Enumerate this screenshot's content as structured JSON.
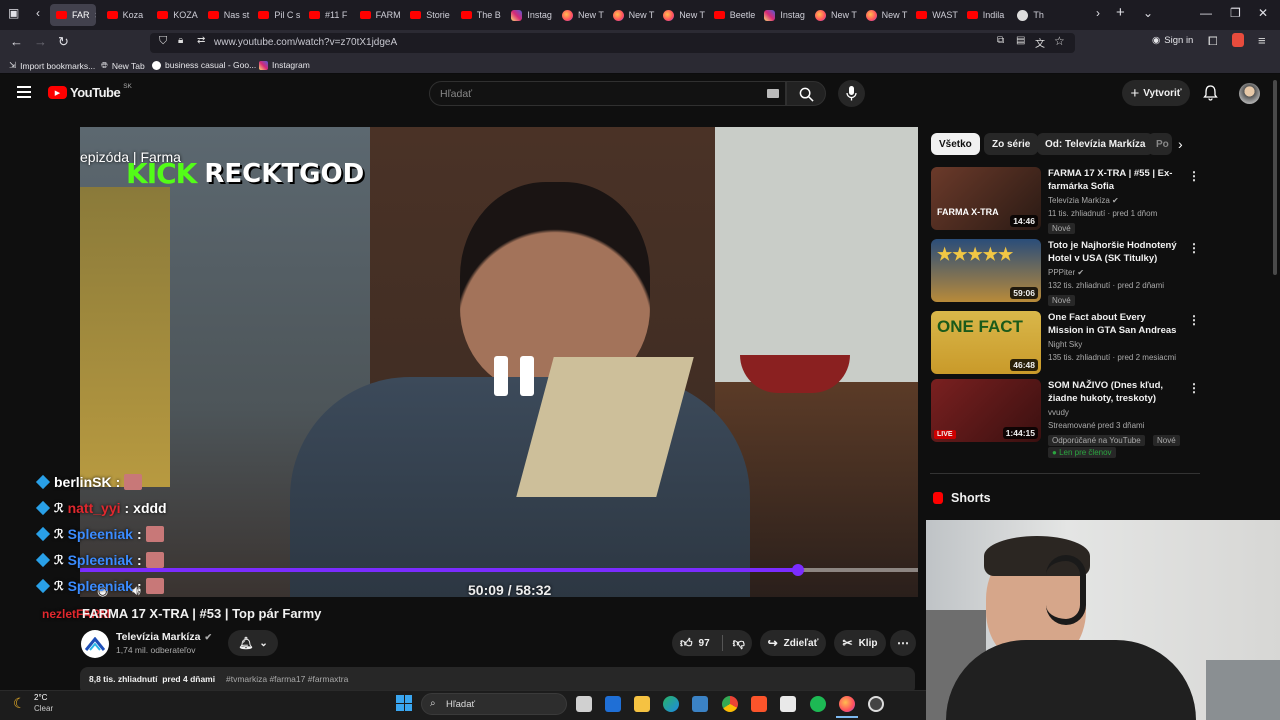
{
  "browser": {
    "tabs": [
      {
        "label": "FAR",
        "kind": "yt",
        "active": true
      },
      {
        "label": "Koza",
        "kind": "yt"
      },
      {
        "label": "KOZA",
        "kind": "yt"
      },
      {
        "label": "Nas st",
        "kind": "yt"
      },
      {
        "label": "Pil C s",
        "kind": "yt"
      },
      {
        "label": "#11 F",
        "kind": "yt"
      },
      {
        "label": "FARM",
        "kind": "yt"
      },
      {
        "label": "Storie",
        "kind": "yt"
      },
      {
        "label": "The B",
        "kind": "yt"
      },
      {
        "label": "Instag",
        "kind": "ig"
      },
      {
        "label": "New T",
        "kind": "ff"
      },
      {
        "label": "New T",
        "kind": "ff"
      },
      {
        "label": "New T",
        "kind": "ff"
      },
      {
        "label": "Beetle",
        "kind": "yt"
      },
      {
        "label": "Instag",
        "kind": "ig"
      },
      {
        "label": "New T",
        "kind": "ff"
      },
      {
        "label": "New T",
        "kind": "ff"
      },
      {
        "label": "WAST",
        "kind": "yt"
      },
      {
        "label": "Indila",
        "kind": "yt"
      },
      {
        "label": "Th",
        "kind": "dark"
      }
    ],
    "url": "www.youtube.com/watch?v=z70tX1jdgeA",
    "sign_in": "Sign in",
    "bookmarks": [
      {
        "label": "Import bookmarks...",
        "icon": "import-icon"
      },
      {
        "label": "New Tab",
        "icon": "globe-icon"
      },
      {
        "label": "business casual - Goo...",
        "icon": "google-icon"
      },
      {
        "label": "Instagram",
        "icon": "instagram-icon"
      }
    ]
  },
  "youtube": {
    "logo": "YouTube",
    "country": "SK",
    "search_placeholder": "Hľadať",
    "create_label": "Vytvoriť",
    "accent": "#ff0000"
  },
  "video": {
    "overlay_top_left": "epizóda | Farma",
    "streamer_kick": "KICK",
    "streamer_name": "RECKTGOD",
    "time": "50:09 / 58:32",
    "progress": 0.857,
    "progress_color": "#7b2cff",
    "title": "FARMA 17 X-TRA | #53 | Top pár Farmy",
    "channel": "Televízia Markíza",
    "subscribers": "1,74 mil. odberateľov",
    "likes": "97",
    "share_label": "Zdieľať",
    "clip_label": "Klip",
    "views_date": "8,8 tis. zhliadnutí  pred 4 dňami",
    "hashtags": "#tvmarkiza #farma17 #farmaxtra"
  },
  "chat": [
    {
      "user": "berlinSK",
      "text": "",
      "color": "#ffffff",
      "emote": true
    },
    {
      "user": "natt_yyi",
      "text": "xddd",
      "color": "#e0282e",
      "emote": false
    },
    {
      "user": "Spleeniak",
      "text": "",
      "color": "#3b8cff",
      "emote": true
    },
    {
      "user": "Spleeniak",
      "text": "",
      "color": "#3b8cff",
      "emote": true
    },
    {
      "user": "Spleeniak",
      "text": "",
      "color": "#3b8cff",
      "emote": true
    }
  ],
  "chat_extra_user": "nezletFARM",
  "filters": [
    "Všetko",
    "Zo série",
    "Od: Televízia Markíza",
    "Po"
  ],
  "recommendations": [
    {
      "title": "FARMA 17 X-TRA | #55 | Ex-farmárka Sofia",
      "channel": "Televízia Markíza",
      "verified": true,
      "meta": "11 tis. zhliadnutí · pred 1 dňom",
      "badge": "Nové",
      "duration": "14:46",
      "thumb_text": "FARMA X-TRA"
    },
    {
      "title": "Toto je Najhoršie Hodnotený Hotel v USA (SK Titulky)",
      "channel": "PPPiter",
      "verified": true,
      "meta": "132 tis. zhliadnutí · pred 2 dňami",
      "badge": "Nové",
      "duration": "59:06",
      "thumb_text": "★★★★★"
    },
    {
      "title": "One Fact about Every Mission in GTA San Andreas",
      "channel": "Night Sky",
      "verified": false,
      "meta": "135 tis. zhliadnutí · pred 2 mesiacmi",
      "badge": "",
      "duration": "46:48",
      "thumb_text": "ONE FACT"
    },
    {
      "title": "SOM NAŽIVO (Dnes kľud, žiadne hukoty, treskoty)",
      "channel": "vvudy",
      "verified": false,
      "meta": "Streamované pred 3 dňami",
      "badge": "Nové",
      "recommended": "Odporúčané na YouTube",
      "members": "Len pre členov",
      "duration": "1:44:15",
      "live_label": "LIVE"
    }
  ],
  "shorts_label": "Shorts",
  "taskbar": {
    "temp": "2°C",
    "weather": "Clear",
    "search_placeholder": "Hľadať"
  }
}
